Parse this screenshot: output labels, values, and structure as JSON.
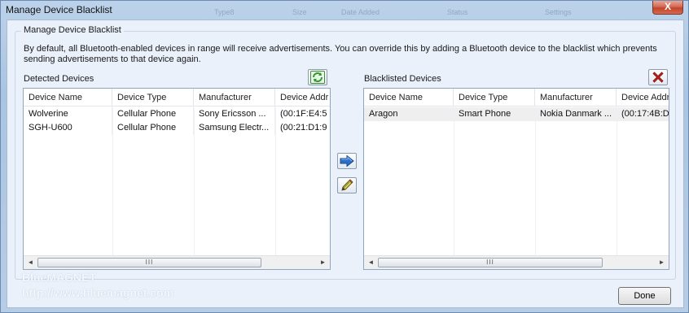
{
  "window": {
    "title": "Manage Device Blacklist",
    "close_glyph": "X",
    "ghost_labels": [
      "Type8",
      "Size",
      "Date Added",
      "Status",
      "Settings"
    ]
  },
  "group": {
    "label": "Manage Device Blacklist",
    "description": "By default, all Bluetooth-enabled devices in range will receive advertisements. You can override this by adding a Bluetooth device to the blacklist which prevents sending advertisements to that device again."
  },
  "detected": {
    "label": "Detected Devices",
    "refresh_icon": "refresh-icon",
    "columns": [
      "Device Name",
      "Device Type",
      "Manufacturer",
      "Device Addr"
    ],
    "rows": [
      [
        "Wolverine",
        "Cellular Phone",
        "Sony Ericsson ...",
        "(00:1F:E4:5"
      ],
      [
        "SGH-U600",
        "Cellular Phone",
        "Samsung Electr...",
        "(00:21:D1:9"
      ]
    ]
  },
  "blacklisted": {
    "label": "Blacklisted Devices",
    "delete_icon": "delete-icon",
    "columns": [
      "Device Name",
      "Device Type",
      "Manufacturer",
      "Device Addr"
    ],
    "rows": [
      [
        "Aragon",
        "Smart Phone",
        "Nokia Danmark ...",
        "(00:17:4B:D"
      ]
    ]
  },
  "center_buttons": {
    "move_icon": "arrow-right-icon",
    "edit_icon": "pencil-icon"
  },
  "scrollbar": {
    "left_arrow": "◄",
    "right_arrow": "►",
    "thumb_grip": "III"
  },
  "branding": {
    "name": "BlueMAGNET",
    "url": "http://www.bluemagnet.com"
  },
  "buttons": {
    "done_label": "Done"
  },
  "colors": {
    "accent_green": "#2e9a2b",
    "delete_red": "#c8201a",
    "arrow_blue": "#2a6fc9"
  }
}
